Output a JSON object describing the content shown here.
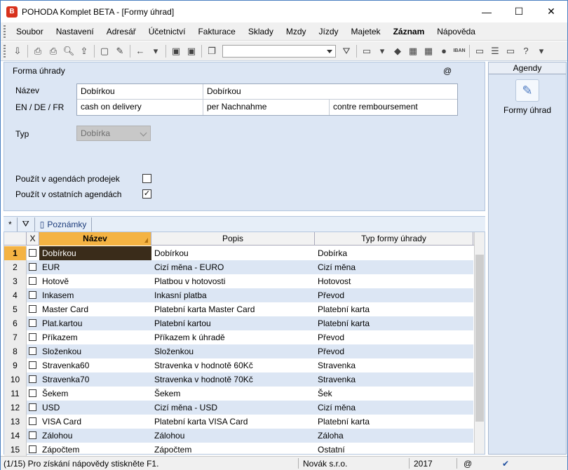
{
  "window": {
    "title": "POHODA Komplet BETA - [Formy úhrad]",
    "app_icon": "pohoda-logo-icon",
    "minimize": "—",
    "maximize": "☐",
    "close": "✕"
  },
  "menu": [
    "Soubor",
    "Nastavení",
    "Adresář",
    "Účetnictví",
    "Fakturace",
    "Sklady",
    "Mzdy",
    "Jízdy",
    "Majetek",
    "Záznam",
    "Nápověda"
  ],
  "form": {
    "section_title": "Forma úhrady",
    "at_sign": "@",
    "labels": {
      "nazev": "Název",
      "lang": "EN / DE / FR",
      "typ": "Typ",
      "prodej": "Použít v agendách prodejek",
      "ostatni": "Použít v ostatních agendách"
    },
    "nazev_1": "Dobírkou",
    "nazev_2": "Dobírkou",
    "en": "cash on delivery",
    "de": "per Nachnahme",
    "fr": "contre remboursement",
    "typ_value": "Dobírka",
    "prodej_checked": false,
    "ostatni_checked": true,
    "check_mark": "✓"
  },
  "agendy": {
    "header": "Agendy",
    "item": "Formy úhrad"
  },
  "tabs": {
    "star": "*",
    "filter_icon": "filter-icon",
    "notes": "Poznámky"
  },
  "table": {
    "headers": {
      "x": "X",
      "nazev": "Název",
      "popis": "Popis",
      "typ": "Typ formy úhrady"
    },
    "rows": [
      {
        "n": "1",
        "nazev": "Dobírkou",
        "popis": "Dobírkou",
        "typ": "Dobírka"
      },
      {
        "n": "2",
        "nazev": "EUR",
        "popis": "Cizí měna - EURO",
        "typ": "Cizí měna"
      },
      {
        "n": "3",
        "nazev": "Hotově",
        "popis": "Platbou v hotovosti",
        "typ": "Hotovost"
      },
      {
        "n": "4",
        "nazev": "Inkasem",
        "popis": "Inkasní platba",
        "typ": "Převod"
      },
      {
        "n": "5",
        "nazev": "Master Card",
        "popis": "Platební karta Master Card",
        "typ": "Platební karta"
      },
      {
        "n": "6",
        "nazev": "Plat.kartou",
        "popis": "Platební kartou",
        "typ": "Platební karta"
      },
      {
        "n": "7",
        "nazev": "Příkazem",
        "popis": "Příkazem k úhradě",
        "typ": "Převod"
      },
      {
        "n": "8",
        "nazev": "Složenkou",
        "popis": "Složenkou",
        "typ": "Převod"
      },
      {
        "n": "9",
        "nazev": "Stravenka60",
        "popis": "Stravenka v hodnotě 60Kč",
        "typ": "Stravenka"
      },
      {
        "n": "10",
        "nazev": "Stravenka70",
        "popis": "Stravenka v hodnotě 70Kč",
        "typ": "Stravenka"
      },
      {
        "n": "11",
        "nazev": "Šekem",
        "popis": "Šekem",
        "typ": "Šek"
      },
      {
        "n": "12",
        "nazev": "USD",
        "popis": "Cizí měna - USD",
        "typ": "Cizí měna"
      },
      {
        "n": "13",
        "nazev": "VISA Card",
        "popis": "Platební karta VISA Card",
        "typ": "Platební karta"
      },
      {
        "n": "14",
        "nazev": "Zálohou",
        "popis": "Zálohou",
        "typ": "Záloha"
      },
      {
        "n": "15",
        "nazev": "Zápočtem",
        "popis": "Zápočtem",
        "typ": "Ostatní"
      }
    ]
  },
  "status": {
    "hint": "(1/15) Pro získání nápovědy stiskněte F1.",
    "user": "Novák s.r.o.",
    "year": "2017",
    "at": "@"
  }
}
